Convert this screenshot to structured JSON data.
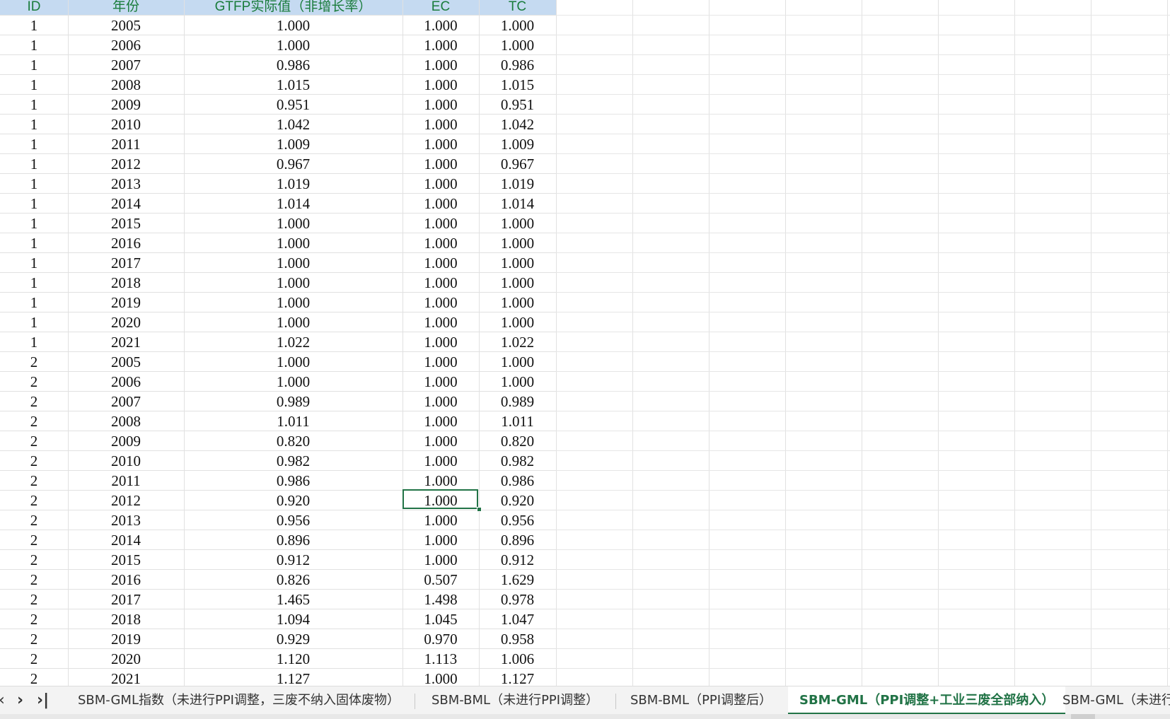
{
  "columns": [
    "ID",
    "年份",
    "GTFP实际值（非增长率）",
    "EC",
    "TC"
  ],
  "rows": [
    [
      "1",
      "2005",
      "1.000",
      "1.000",
      "1.000"
    ],
    [
      "1",
      "2006",
      "1.000",
      "1.000",
      "1.000"
    ],
    [
      "1",
      "2007",
      "0.986",
      "1.000",
      "0.986"
    ],
    [
      "1",
      "2008",
      "1.015",
      "1.000",
      "1.015"
    ],
    [
      "1",
      "2009",
      "0.951",
      "1.000",
      "0.951"
    ],
    [
      "1",
      "2010",
      "1.042",
      "1.000",
      "1.042"
    ],
    [
      "1",
      "2011",
      "1.009",
      "1.000",
      "1.009"
    ],
    [
      "1",
      "2012",
      "0.967",
      "1.000",
      "0.967"
    ],
    [
      "1",
      "2013",
      "1.019",
      "1.000",
      "1.019"
    ],
    [
      "1",
      "2014",
      "1.014",
      "1.000",
      "1.014"
    ],
    [
      "1",
      "2015",
      "1.000",
      "1.000",
      "1.000"
    ],
    [
      "1",
      "2016",
      "1.000",
      "1.000",
      "1.000"
    ],
    [
      "1",
      "2017",
      "1.000",
      "1.000",
      "1.000"
    ],
    [
      "1",
      "2018",
      "1.000",
      "1.000",
      "1.000"
    ],
    [
      "1",
      "2019",
      "1.000",
      "1.000",
      "1.000"
    ],
    [
      "1",
      "2020",
      "1.000",
      "1.000",
      "1.000"
    ],
    [
      "1",
      "2021",
      "1.022",
      "1.000",
      "1.022"
    ],
    [
      "2",
      "2005",
      "1.000",
      "1.000",
      "1.000"
    ],
    [
      "2",
      "2006",
      "1.000",
      "1.000",
      "1.000"
    ],
    [
      "2",
      "2007",
      "0.989",
      "1.000",
      "0.989"
    ],
    [
      "2",
      "2008",
      "1.011",
      "1.000",
      "1.011"
    ],
    [
      "2",
      "2009",
      "0.820",
      "1.000",
      "0.820"
    ],
    [
      "2",
      "2010",
      "0.982",
      "1.000",
      "0.982"
    ],
    [
      "2",
      "2011",
      "0.986",
      "1.000",
      "0.986"
    ],
    [
      "2",
      "2012",
      "0.920",
      "1.000",
      "0.920"
    ],
    [
      "2",
      "2013",
      "0.956",
      "1.000",
      "0.956"
    ],
    [
      "2",
      "2014",
      "0.896",
      "1.000",
      "0.896"
    ],
    [
      "2",
      "2015",
      "0.912",
      "1.000",
      "0.912"
    ],
    [
      "2",
      "2016",
      "0.826",
      "0.507",
      "1.629"
    ],
    [
      "2",
      "2017",
      "1.465",
      "1.498",
      "0.978"
    ],
    [
      "2",
      "2018",
      "1.094",
      "1.045",
      "1.047"
    ],
    [
      "2",
      "2019",
      "0.929",
      "0.970",
      "0.958"
    ],
    [
      "2",
      "2020",
      "1.120",
      "1.113",
      "1.006"
    ],
    [
      "2",
      "2021",
      "1.127",
      "1.000",
      "1.127"
    ]
  ],
  "selected_cell": {
    "row": 25,
    "column": "EC"
  },
  "tab_nav": {
    "prev_icon": "chevron-left-icon",
    "next_icon": "chevron-right-icon",
    "last_icon": "skip-to-last-icon"
  },
  "tabs": [
    {
      "label": "SBM-GML指数（未进行PPI调整，三废不纳入固体废物）",
      "active": false
    },
    {
      "label": "SBM-BML（未进行PPI调整）",
      "active": false
    },
    {
      "label": "SBM-BML（PPI调整后）",
      "active": false
    },
    {
      "label": "SBM-GML（PPI调整+工业三废全部纳入）",
      "active": true
    },
    {
      "label": "SBM-GML（未进行",
      "active": false
    }
  ],
  "colors": {
    "header_bg": "#c5daf1",
    "header_text": "#1a7c3c",
    "accent": "#217346",
    "gridline": "#e1e1e1"
  }
}
